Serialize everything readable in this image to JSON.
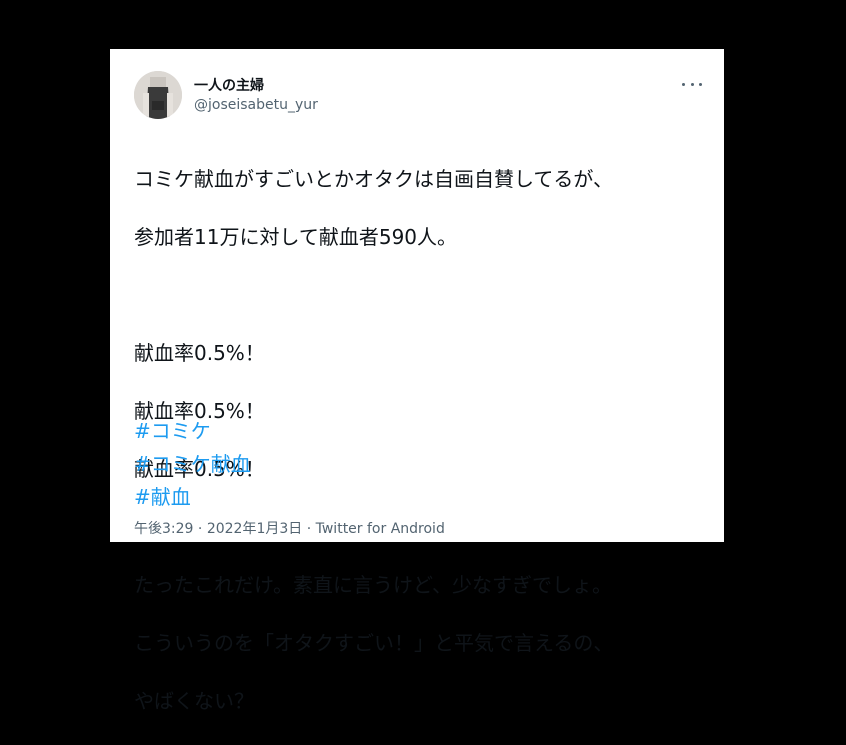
{
  "tweet": {
    "display_name": "一人の主婦",
    "handle": "@joseisabetu_yur",
    "text_lines": [
      "コミケ献血がすごいとかオタクは自画自賛してるが、",
      "参加者11万に対して献血者590人。",
      "",
      "献血率0.5%！",
      "献血率0.5%！",
      "献血率0.5%！",
      "",
      "たったこれだけ。素直に言うけど、少なすぎでしょ。",
      "こういうのを「オタクすごい！」と平気で言えるの、",
      "やばくない？"
    ],
    "hashtags": [
      "#コミケ",
      "#コミケ献血",
      "#献血"
    ],
    "time": "午後3:29",
    "date": "2022年1月3日",
    "separator": "·",
    "source": "Twitter for Android",
    "more_icon": "more-icon"
  },
  "colors": {
    "background": "#000000",
    "card": "#ffffff",
    "hashtag": "#1d9bf0",
    "secondary_text": "#536471"
  }
}
